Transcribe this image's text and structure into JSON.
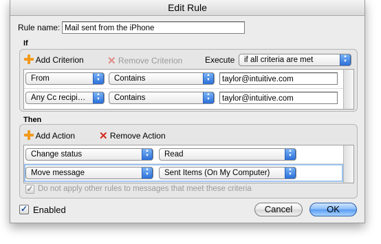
{
  "window": {
    "title": "Edit Rule"
  },
  "rule_name": {
    "label": "Rule name:",
    "value": "Mail sent from the iPhone"
  },
  "if_section": {
    "label": "If",
    "add_label": "Add Criterion",
    "remove_label": "Remove Criterion",
    "execute_label": "Execute",
    "execute_value": "if all criteria are met",
    "criteria": [
      {
        "field": "From",
        "operator": "Contains",
        "value": "taylor@intuitive.com"
      },
      {
        "field": "Any Cc recipi…",
        "operator": "Contains",
        "value": "taylor@intuitive.com"
      }
    ]
  },
  "then_section": {
    "label": "Then",
    "add_label": "Add Action",
    "remove_label": "Remove Action",
    "actions": [
      {
        "action": "Change status",
        "value": "Read"
      },
      {
        "action": "Move message",
        "value": "Sent Items (On My Computer)"
      }
    ],
    "stop_rules": {
      "label": "Do not apply other rules to messages that meet these criteria",
      "checked": true
    }
  },
  "enabled": {
    "label": "Enabled",
    "checked": true
  },
  "buttons": {
    "cancel": "Cancel",
    "ok": "OK"
  },
  "colors": {
    "accent": "#3b82f0",
    "add_icon": "#f29a1c",
    "remove_icon": "#d42a1e"
  }
}
